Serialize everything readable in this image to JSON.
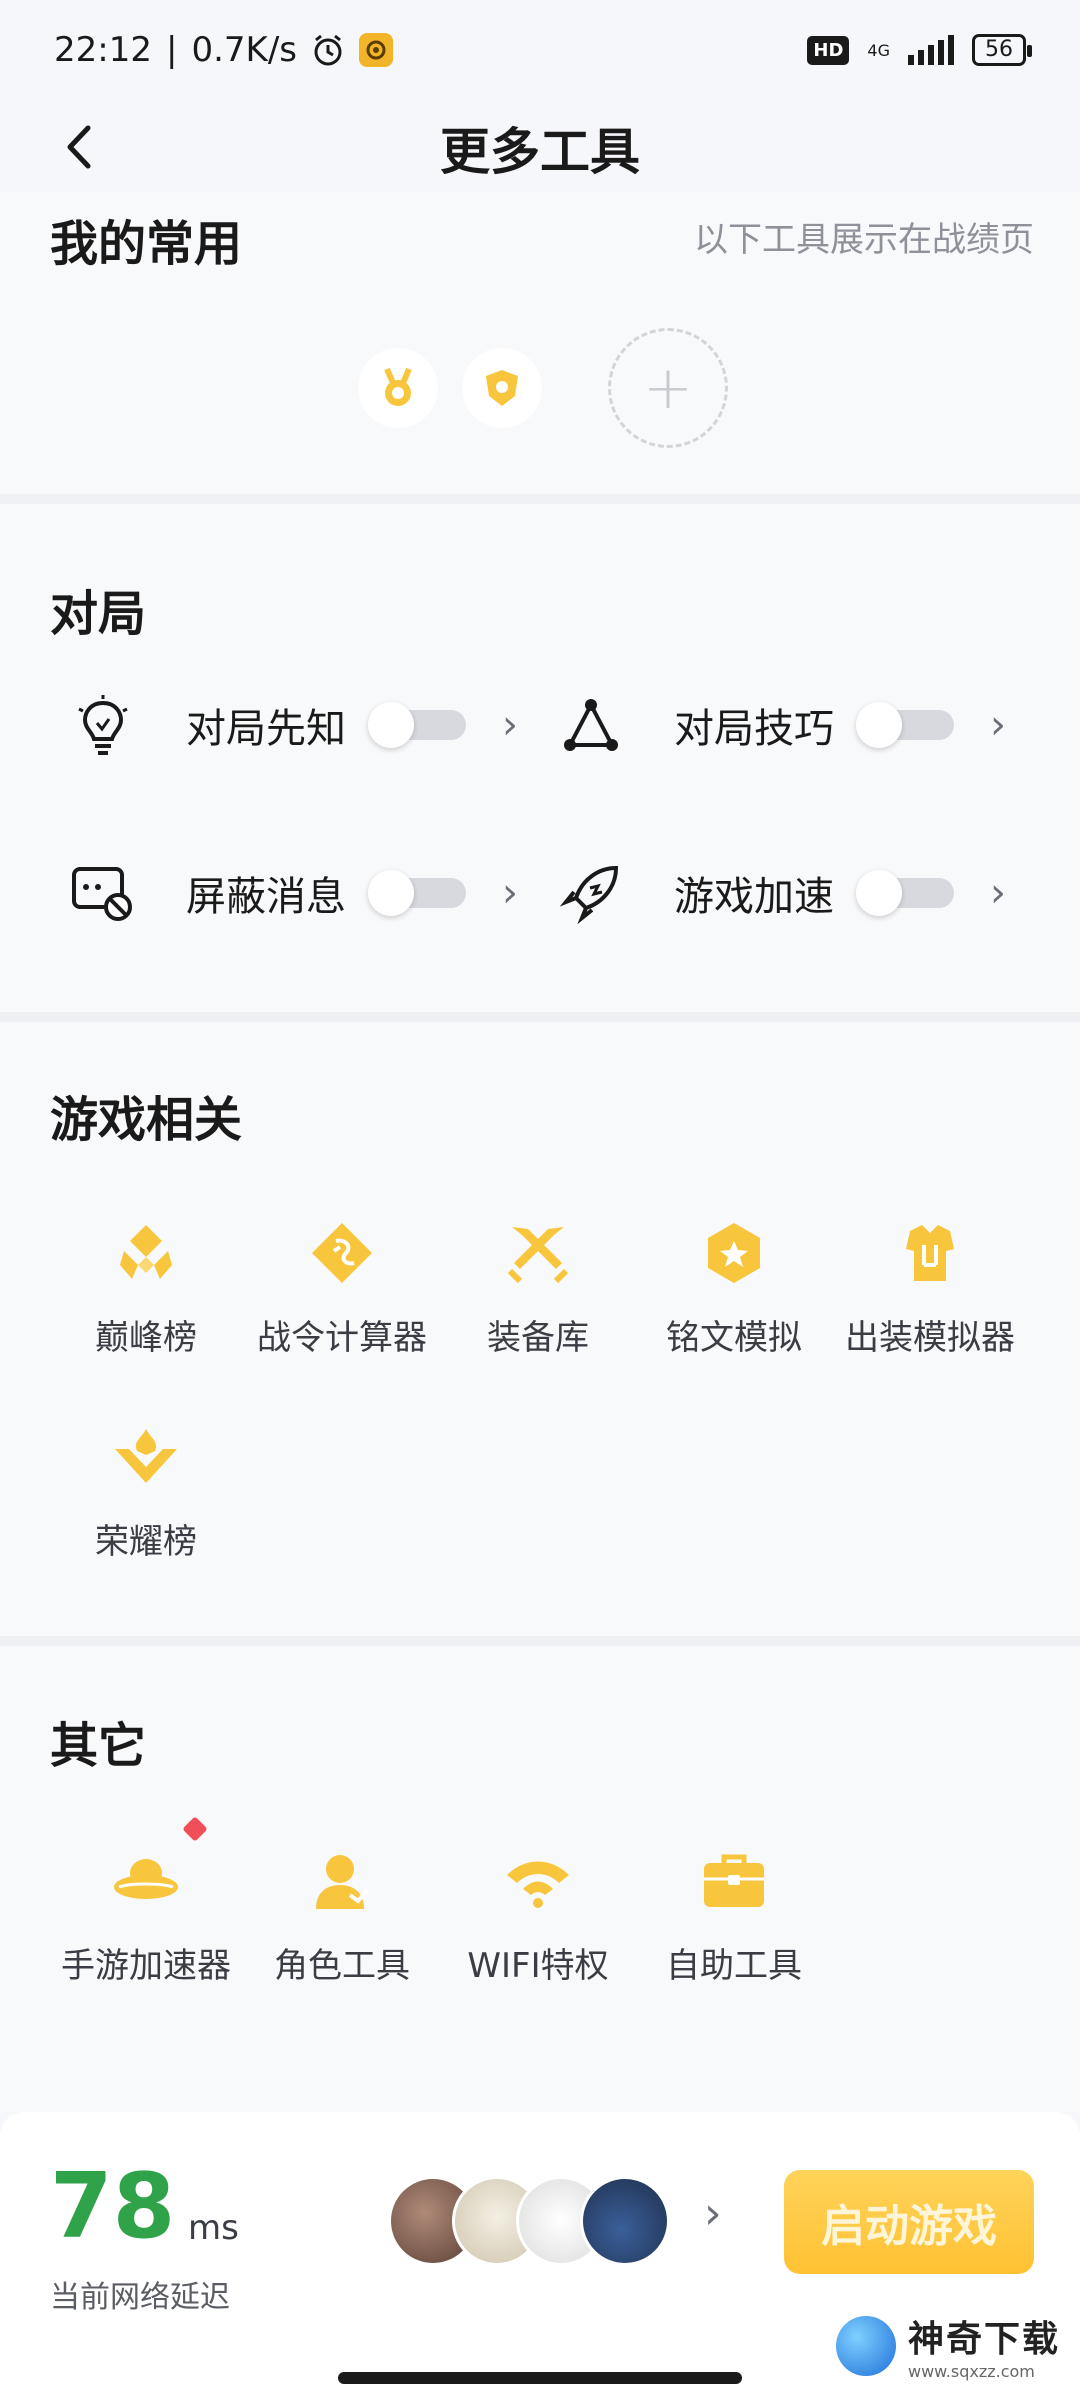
{
  "status_bar": {
    "time": "22:12",
    "speed": "0.7K/s",
    "hd": "HD",
    "net": "4G",
    "battery": "56"
  },
  "header": {
    "title": "更多工具"
  },
  "favorites": {
    "title": "我的常用",
    "hint": "以下工具展示在战绩页",
    "add_symbol": "+"
  },
  "match": {
    "title": "对局",
    "items": [
      {
        "label": "对局先知",
        "enabled": false
      },
      {
        "label": "对局技巧",
        "enabled": false
      },
      {
        "label": "屏蔽消息",
        "enabled": false
      },
      {
        "label": "游戏加速",
        "enabled": false
      }
    ]
  },
  "game": {
    "title": "游戏相关",
    "items": [
      {
        "label": "巅峰榜"
      },
      {
        "label": "战令计算器"
      },
      {
        "label": "装备库"
      },
      {
        "label": "铭文模拟"
      },
      {
        "label": "出装模拟器"
      },
      {
        "label": "荣耀榜"
      }
    ]
  },
  "other": {
    "title": "其它",
    "items": [
      {
        "label": "手游加速器"
      },
      {
        "label": "角色工具"
      },
      {
        "label": "WIFI特权"
      },
      {
        "label": "自助工具"
      }
    ]
  },
  "bottom": {
    "latency_value": "78",
    "latency_unit": "ms",
    "latency_label": "当前网络延迟",
    "launch_label": "启动游戏"
  },
  "watermark": {
    "title": "神奇下载",
    "url": "www.sqxzz.com"
  },
  "colors": {
    "accent": "#f8c63d",
    "latency": "#2fa24a",
    "badge": "#f04f5a"
  }
}
